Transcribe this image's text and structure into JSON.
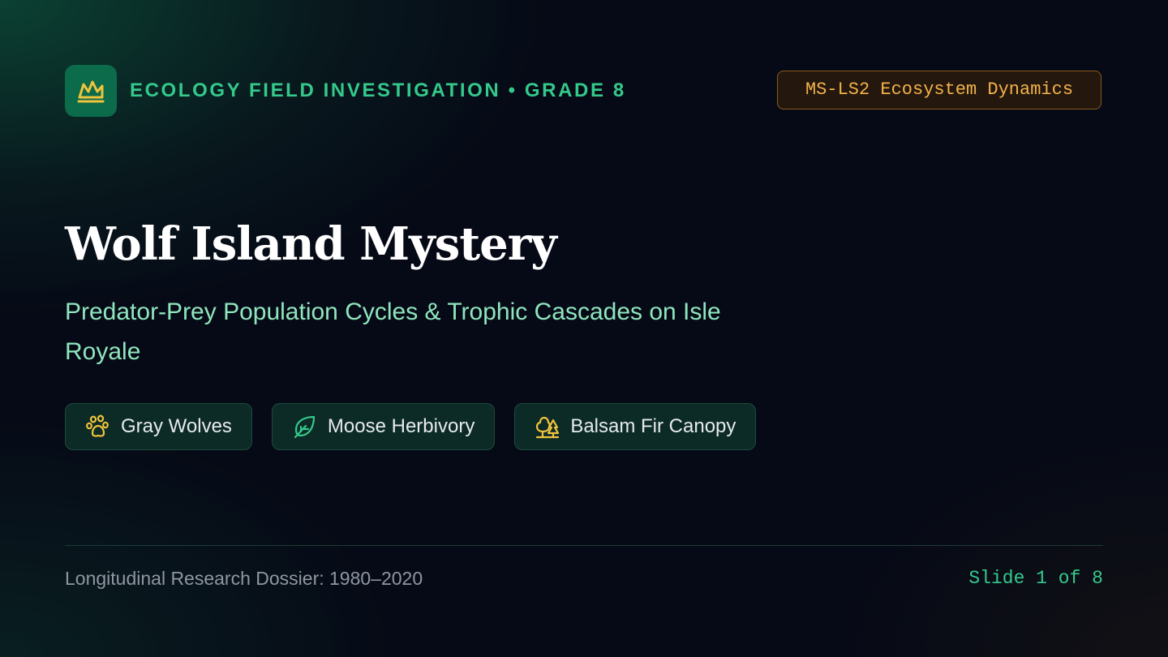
{
  "header": {
    "logo_icon": "mountain-crown-icon",
    "kicker": "ECOLOGY FIELD INVESTIGATION • GRADE 8",
    "standard_badge": "MS-LS2 Ecosystem Dynamics"
  },
  "main": {
    "title": "Wolf Island Mystery",
    "subtitle": "Predator-Prey Population Cycles & Trophic Cascades on Isle Royale",
    "chips": [
      {
        "icon": "paw-print-icon",
        "label": "Gray Wolves"
      },
      {
        "icon": "leaf-icon",
        "label": "Moose Herbivory"
      },
      {
        "icon": "trees-icon",
        "label": "Balsam Fir Canopy"
      }
    ]
  },
  "footer": {
    "left_text": "Longitudinal Research Dossier: 1980–2020",
    "slide_indicator": "Slide 1 of 8"
  },
  "colors": {
    "accent_green": "#34c98b",
    "subtitle_green": "#8fe6be",
    "icon_gold": "#f0c33c",
    "badge_text": "#f3b34a",
    "background": "#060a16"
  }
}
